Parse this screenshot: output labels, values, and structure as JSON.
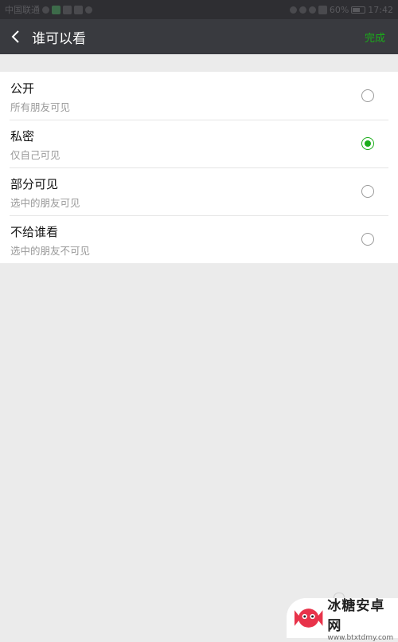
{
  "status_bar": {
    "carrier": "中国联通",
    "battery": "60%",
    "time": "17:42"
  },
  "header": {
    "title": "谁可以看",
    "done_label": "完成"
  },
  "options": [
    {
      "label": "公开",
      "description": "所有朋友可见",
      "selected": false
    },
    {
      "label": "私密",
      "description": "仅自己可见",
      "selected": true
    },
    {
      "label": "部分可见",
      "description": "选中的朋友可见",
      "selected": false
    },
    {
      "label": "不给谁看",
      "description": "选中的朋友不可见",
      "selected": false
    }
  ],
  "watermark": {
    "title": "冰糖安卓网",
    "url": "www.btxtdmy.com"
  },
  "colors": {
    "accent": "#1aad19",
    "header_bg": "#393a3f",
    "page_bg": "#ebebeb"
  },
  "icons": [
    "back-chevron-icon",
    "radio-icon",
    "candy-logo-icon"
  ]
}
